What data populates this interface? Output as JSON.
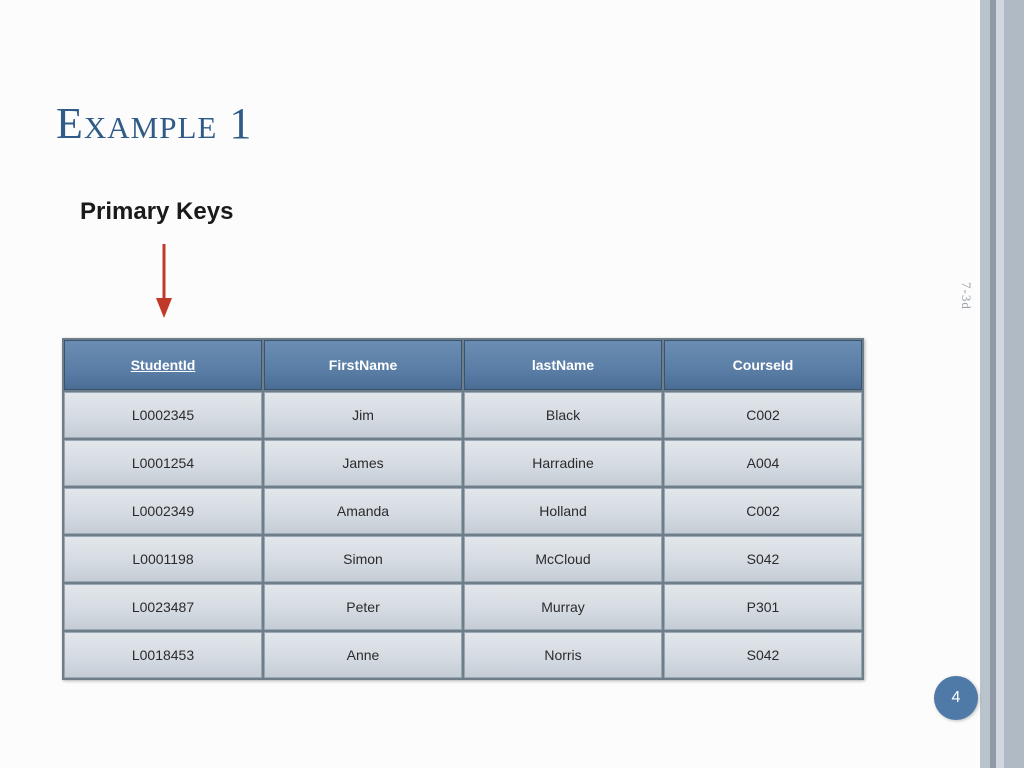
{
  "slide": {
    "title": "Example 1",
    "annotation": "Primary Keys",
    "side_label": "7-3d",
    "page_number": "4"
  },
  "table": {
    "headers": [
      {
        "label": "StudentId",
        "primary_key": true
      },
      {
        "label": "FirstName",
        "primary_key": false
      },
      {
        "label": "lastName",
        "primary_key": false
      },
      {
        "label": "CourseId",
        "primary_key": false
      }
    ],
    "rows": [
      {
        "studentId": "L0002345",
        "firstName": "Jim",
        "lastName": "Black",
        "courseId": "C002"
      },
      {
        "studentId": "L0001254",
        "firstName": "James",
        "lastName": "Harradine",
        "courseId": "A004"
      },
      {
        "studentId": "L0002349",
        "firstName": "Amanda",
        "lastName": "Holland",
        "courseId": "C002"
      },
      {
        "studentId": "L0001198",
        "firstName": "Simon",
        "lastName": "McCloud",
        "courseId": "S042"
      },
      {
        "studentId": "L0023487",
        "firstName": "Peter",
        "lastName": "Murray",
        "courseId": "P301"
      },
      {
        "studentId": "L0018453",
        "firstName": "Anne",
        "lastName": "Norris",
        "courseId": "S042"
      }
    ]
  }
}
